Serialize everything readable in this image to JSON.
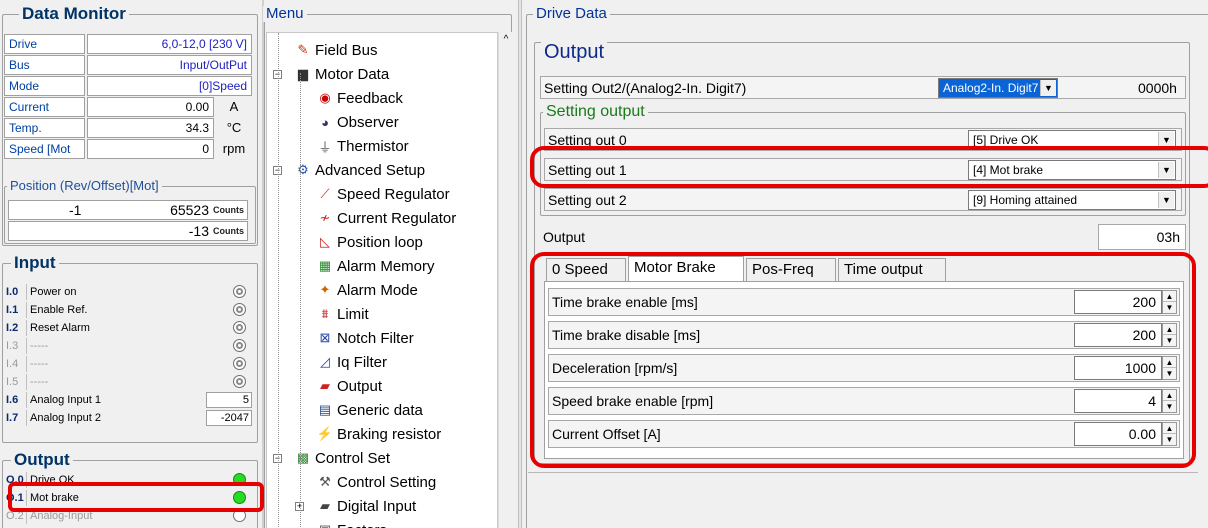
{
  "data_monitor": {
    "title": "Data Monitor",
    "rows": [
      {
        "label": "Drive",
        "value": "6,0-12,0 [230 V]",
        "unit": ""
      },
      {
        "label": "Bus",
        "value": "Input/OutPut",
        "unit": ""
      },
      {
        "label": "Mode",
        "value": "[0]Speed",
        "unit": ""
      },
      {
        "label": "Current",
        "value": "0.00",
        "unit": "A"
      },
      {
        "label": "Temp.",
        "value": "34.3",
        "unit": "°C"
      },
      {
        "label": "Speed [Mot",
        "value": "0",
        "unit": "rpm"
      }
    ],
    "position_title": "Position (Rev/Offset)[Mot]",
    "position_rows": [
      {
        "a": "-1",
        "b": "65523",
        "unit": "Counts"
      },
      {
        "a": "",
        "b": "-13",
        "unit": "Counts"
      }
    ]
  },
  "input": {
    "title": "Input",
    "rows": [
      {
        "id": "I.0",
        "name": "Power on",
        "type": "led",
        "dim": false
      },
      {
        "id": "I.1",
        "name": "Enable Ref.",
        "type": "led",
        "dim": false
      },
      {
        "id": "I.2",
        "name": "Reset Alarm",
        "type": "led",
        "dim": false
      },
      {
        "id": "I.3",
        "name": "-----",
        "type": "led",
        "dim": true
      },
      {
        "id": "I.4",
        "name": "-----",
        "type": "led",
        "dim": true
      },
      {
        "id": "I.5",
        "name": "-----",
        "type": "led",
        "dim": true
      },
      {
        "id": "I.6",
        "name": "Analog Input 1",
        "type": "num",
        "value": "5",
        "dim": false
      },
      {
        "id": "I.7",
        "name": "Analog Input 2",
        "type": "num",
        "value": "-2047",
        "dim": false
      }
    ]
  },
  "output": {
    "title": "Output",
    "rows": [
      {
        "id": "O.0",
        "name": "Drive OK",
        "state": "on",
        "dim": false
      },
      {
        "id": "O.1",
        "name": "Mot brake",
        "state": "on",
        "dim": false
      },
      {
        "id": "O.2",
        "name": "Analog-Input",
        "state": "off",
        "dim": true
      }
    ]
  },
  "menu": {
    "title": "Menu",
    "items": [
      {
        "label": "Field Bus",
        "icon": "fieldbus-icon",
        "glyph": "✎",
        "color": "#cc3300"
      },
      {
        "label": "Motor Data",
        "icon": "motor-icon",
        "glyph": "▆",
        "color": "#333333"
      },
      {
        "label": "Feedback",
        "icon": "feedback-icon",
        "glyph": "◉",
        "color": "#cc0000"
      },
      {
        "label": "Observer",
        "icon": "observer-icon",
        "glyph": "◕",
        "color": "#333366"
      },
      {
        "label": "Thermistor",
        "icon": "thermistor-icon",
        "glyph": "⏚",
        "color": "#555555"
      },
      {
        "label": "Advanced Setup",
        "icon": "advanced-setup-icon",
        "glyph": "⚙",
        "color": "#2255aa"
      },
      {
        "label": "Speed Regulator",
        "icon": "speed-regulator-icon",
        "glyph": "⟋",
        "color": "#cc2222"
      },
      {
        "label": "Current Regulator",
        "icon": "current-regulator-icon",
        "glyph": "≁",
        "color": "#cc2222"
      },
      {
        "label": "Position loop",
        "icon": "position-loop-icon",
        "glyph": "◺",
        "color": "#cc2222"
      },
      {
        "label": "Alarm Memory",
        "icon": "alarm-memory-icon",
        "glyph": "▦",
        "color": "#228822"
      },
      {
        "label": "Alarm Mode",
        "icon": "alarm-mode-icon",
        "glyph": "✦",
        "color": "#cc6600"
      },
      {
        "label": "Limit",
        "icon": "limit-icon",
        "glyph": "⩩",
        "color": "#cc2222"
      },
      {
        "label": "Notch Filter",
        "icon": "notch-filter-icon",
        "glyph": "⊠",
        "color": "#2244aa"
      },
      {
        "label": "Iq Filter",
        "icon": "iq-filter-icon",
        "glyph": "◿",
        "color": "#2244aa"
      },
      {
        "label": "Output",
        "icon": "output-icon",
        "glyph": "▰",
        "color": "#cc2222"
      },
      {
        "label": "Generic data",
        "icon": "generic-data-icon",
        "glyph": "▤",
        "color": "#224488"
      },
      {
        "label": "Braking resistor",
        "icon": "braking-resistor-icon",
        "glyph": "⚡",
        "color": "#dd7700"
      },
      {
        "label": "Control Set",
        "icon": "control-set-icon",
        "glyph": "▩",
        "color": "#338833"
      },
      {
        "label": "Control Setting",
        "icon": "control-setting-icon",
        "glyph": "⚒",
        "color": "#555555"
      },
      {
        "label": "Digital Input",
        "icon": "digital-input-icon",
        "glyph": "▰",
        "color": "#444444"
      },
      {
        "label": "Factors",
        "icon": "factors-icon",
        "glyph": "▣",
        "color": "#444444"
      }
    ]
  },
  "drive_data": {
    "title": "Drive Data",
    "output_title": "Output",
    "setting_out2_label": "Setting Out2/(Analog2-In. Digit7)",
    "setting_out2_value": "Analog2-In. Digit7",
    "setting_out2_hex": "0000h",
    "setting_output_title": "Setting output",
    "setting_rows": [
      {
        "label": "Setting out 0",
        "value": "[5] Drive OK"
      },
      {
        "label": "Setting out 1",
        "value": "[4] Mot brake"
      },
      {
        "label": "Setting out 2",
        "value": "[9] Homing attained"
      }
    ],
    "output_label": "Output",
    "output_value": "03h",
    "tabs": [
      "0 Speed",
      "Motor Brake",
      "Pos-Freq",
      "Time output"
    ],
    "active_tab": 1,
    "params": [
      {
        "label": "Time brake enable [ms]",
        "value": "200"
      },
      {
        "label": "Time brake disable [ms]",
        "value": "200"
      },
      {
        "label": "Deceleration [rpm/s]",
        "value": "1000"
      },
      {
        "label": "Speed brake enable [rpm]",
        "value": "4"
      },
      {
        "label": "Current Offset [A]",
        "value": "0.00"
      }
    ]
  },
  "colors": {
    "highlight": "#e60000",
    "selected_combo_bg": "#0a64d6",
    "led_on": "#22dd22"
  }
}
